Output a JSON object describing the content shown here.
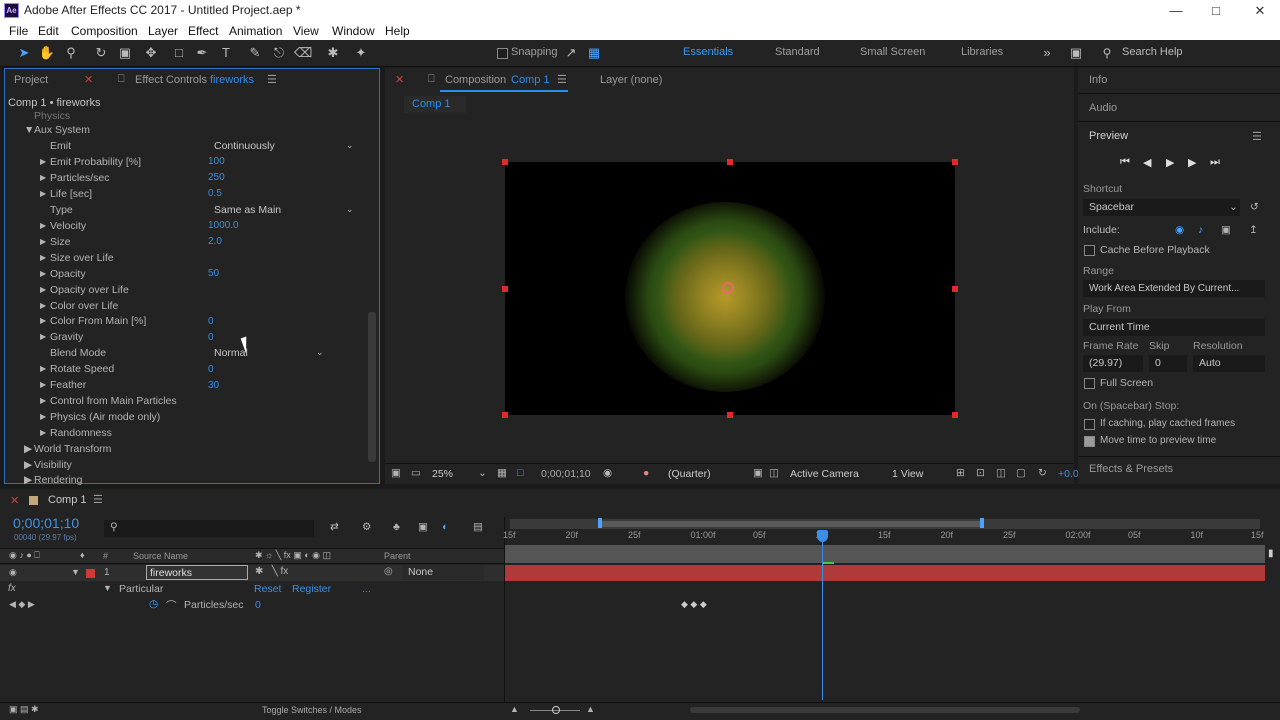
{
  "app": {
    "title": "Adobe After Effects CC 2017 - Untitled Project.aep *",
    "icon": "Ae"
  },
  "menu": [
    "File",
    "Edit",
    "Composition",
    "Layer",
    "Effect",
    "Animation",
    "View",
    "Window",
    "Help"
  ],
  "toolbar": {
    "snapping": "Snapping",
    "workspaces": [
      "Essentials",
      "Standard",
      "Small Screen",
      "Libraries"
    ],
    "search_placeholder": "Search Help"
  },
  "left_panel": {
    "tab_project": "Project",
    "tab_effect_prefix": "Effect Controls",
    "tab_effect_layer": "fireworks",
    "breadcrumb": "Comp 1 • fireworks",
    "physics": "Physics",
    "aux": "Aux System",
    "rows": [
      {
        "label": "Emit",
        "value": "Continuously",
        "kind": "dropdown"
      },
      {
        "label": "Emit Probability [%]",
        "value": "100",
        "kind": "value"
      },
      {
        "label": "Particles/sec",
        "value": "250",
        "kind": "value"
      },
      {
        "label": "Life [sec]",
        "value": "0.5",
        "kind": "value"
      },
      {
        "label": "Type",
        "value": "Same as Main",
        "kind": "dropdown"
      },
      {
        "label": "Velocity",
        "value": "1000.0",
        "kind": "value"
      },
      {
        "label": "Size",
        "value": "2.0",
        "kind": "value"
      },
      {
        "label": "Size over Life",
        "value": "",
        "kind": "group"
      },
      {
        "label": "Opacity",
        "value": "50",
        "kind": "value"
      },
      {
        "label": "Opacity over Life",
        "value": "",
        "kind": "group"
      },
      {
        "label": "Color over Life",
        "value": "",
        "kind": "group"
      },
      {
        "label": "Color From Main [%]",
        "value": "0",
        "kind": "value"
      },
      {
        "label": "Gravity",
        "value": "0",
        "kind": "value"
      },
      {
        "label": "Blend Mode",
        "value": "Normal",
        "kind": "dropdown"
      },
      {
        "label": "Rotate Speed",
        "value": "0",
        "kind": "value"
      },
      {
        "label": "Feather",
        "value": "30",
        "kind": "value"
      },
      {
        "label": "Control from Main Particles",
        "value": "",
        "kind": "group"
      },
      {
        "label": "Physics (Air mode only)",
        "value": "",
        "kind": "group"
      },
      {
        "label": "Randomness",
        "value": "",
        "kind": "group"
      }
    ],
    "world_transform": "World Transform",
    "visibility": "Visibility",
    "rendering": "Rendering"
  },
  "comp_panel": {
    "tab_prefix": "Composition",
    "tab_comp": "Comp 1",
    "layer_tab": "Layer (none)",
    "subtab": "Comp 1",
    "zoom": "25%",
    "time": "0;00;01;10",
    "quality": "(Quarter)",
    "camera": "Active Camera",
    "view": "1 View",
    "offset": "+0.0"
  },
  "right_panel": {
    "info": "Info",
    "audio": "Audio",
    "preview": "Preview",
    "shortcut_label": "Shortcut",
    "shortcut": "Spacebar",
    "include": "Include:",
    "cache": "Cache Before Playback",
    "range_label": "Range",
    "range": "Work Area Extended By Current...",
    "playfrom_label": "Play From",
    "playfrom": "Current Time",
    "framerate_label": "Frame Rate",
    "skip_label": "Skip",
    "resolution_label": "Resolution",
    "framerate": "(29.97)",
    "skip": "0",
    "resolution": "Auto",
    "fullscreen": "Full Screen",
    "onstop": "On (Spacebar) Stop:",
    "ifcaching": "If caching, play cached frames",
    "movetime": "Move time to preview time",
    "effects": "Effects & Presets"
  },
  "timeline": {
    "tab": "Comp 1",
    "timecode": "0;00;01;10",
    "fps": "00040 (29.97 fps)",
    "col_num": "#",
    "col_source": "Source Name",
    "col_parent": "Parent",
    "layer_num": "1",
    "layer_name": "fireworks",
    "parent": "None",
    "effect": "Particular",
    "reset": "Reset",
    "register": "Register",
    "more": "...",
    "prop": "Particles/sec",
    "prop_val": "0",
    "ticks": [
      "15f",
      "20f",
      "25f",
      "01:00f",
      "05f",
      "10f",
      "15f",
      "20f",
      "25f",
      "02:00f",
      "05f",
      "10f",
      "15f"
    ],
    "footer": "Toggle Switches / Modes"
  }
}
